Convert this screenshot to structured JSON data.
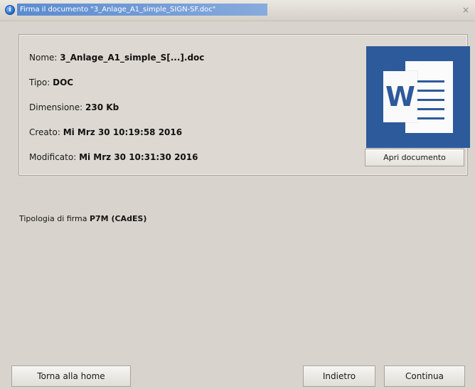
{
  "window": {
    "title": "Firma il documento \"3_Anlage_A1_simple_SIGN-SF.doc\"",
    "close_symbol": "×"
  },
  "icons": {
    "app": "app-icon",
    "close": "close-icon",
    "word": "word-document-icon"
  },
  "document": {
    "name_label": "Nome:",
    "name_value": "3_Anlage_A1_simple_S[...].doc",
    "type_label": "Tipo:",
    "type_value": "DOC",
    "size_label": "Dimensione:",
    "size_value": "230 Kb",
    "created_label": "Creato:",
    "created_value": "Mi Mrz 30 10:19:58 2016",
    "modified_label": "Modificato:",
    "modified_value": "Mi Mrz 30 10:31:30 2016",
    "preview_letter": "W",
    "open_button": "Apri documento"
  },
  "signature": {
    "label": "Tipologia di firma",
    "value": "P7M (CAdES)"
  },
  "footer": {
    "home_button": "Torna alla home",
    "back_button": "Indietro",
    "continue_button": "Continua"
  },
  "colors": {
    "window_bg": "#d8d4cd",
    "panel_bg": "#ddd9d2",
    "word_blue": "#2d5a9b",
    "title_blue": "#4d82cf"
  }
}
